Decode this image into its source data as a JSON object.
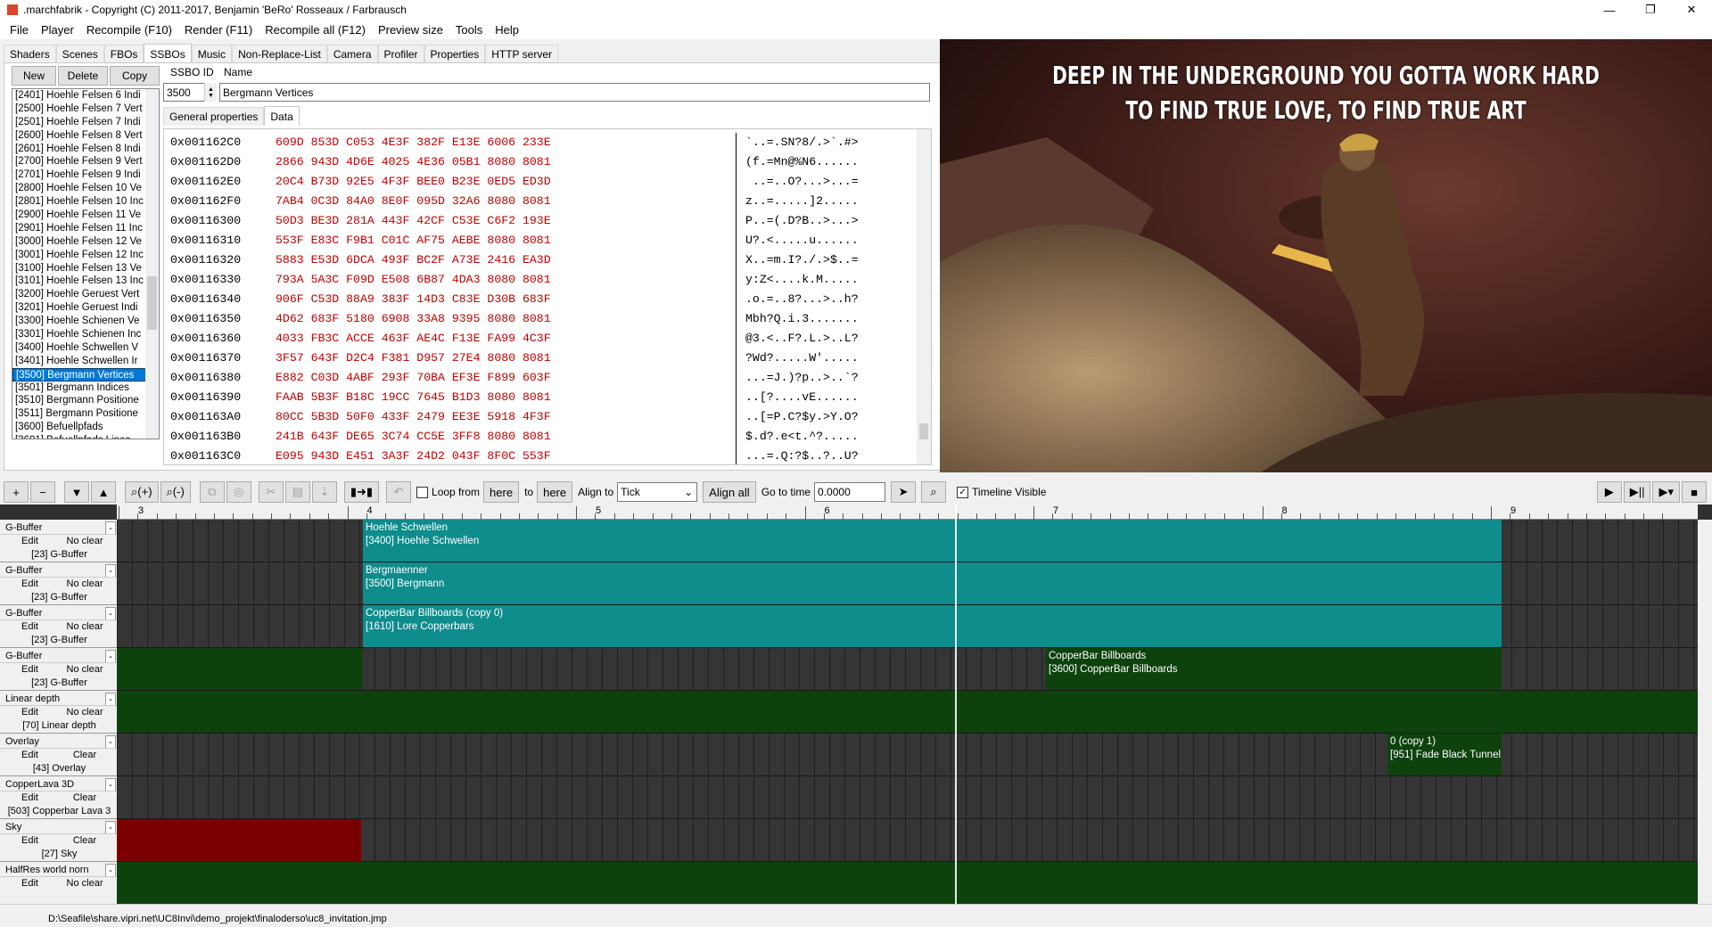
{
  "window": {
    "title": ".marchfabrik - Copyright (C) 2011-2017, Benjamin 'BeRo' Rosseaux / Farbrausch"
  },
  "menu": [
    "File",
    "Player",
    "Recompile (F10)",
    "Render (F11)",
    "Recompile all (F12)",
    "Preview size",
    "Tools",
    "Help"
  ],
  "tabs": [
    "Shaders",
    "Scenes",
    "FBOs",
    "SSBOs",
    "Music",
    "Non-Replace-List",
    "Camera",
    "Profiler",
    "Properties",
    "HTTP server"
  ],
  "active_tab": "SSBOs",
  "list_buttons": {
    "new": "New",
    "delete": "Delete",
    "copy": "Copy"
  },
  "ssbo_list": [
    "[2401] Hoehle Felsen 6 Indi",
    "[2500] Hoehle Felsen 7 Vert",
    "[2501] Hoehle Felsen 7 Indi",
    "[2600] Hoehle Felsen 8 Vert",
    "[2601] Hoehle Felsen 8 Indi",
    "[2700] Hoehle Felsen 9 Vert",
    "[2701] Hoehle Felsen 9 Indi",
    "[2800] Hoehle Felsen 10 Ve",
    "[2801] Hoehle Felsen 10 Inc",
    "[2900] Hoehle Felsen 11 Ve",
    "[2901] Hoehle Felsen 11 Inc",
    "[3000] Hoehle Felsen 12 Ve",
    "[3001] Hoehle Felsen 12 Inc",
    "[3100] Hoehle Felsen 13 Ve",
    "[3101] Hoehle Felsen 13 Inc",
    "[3200] Hoehle Geruest Vert",
    "[3201] Hoehle Geruest Indi",
    "[3300] Hoehle Schienen Ve",
    "[3301] Hoehle Schienen Inc",
    "[3400] Hoehle Schwellen V",
    "[3401] Hoehle Schwellen Ir",
    "[3500] Bergmann Vertices",
    "[3501] Bergmann Indices",
    "[3510] Bergmann Positione",
    "[3511] Bergmann Positione",
    "[3600] Befuellpfads",
    "[3601] Befuellpfads Lines"
  ],
  "selected_ssbo": "[3500] Bergmann Vertices",
  "form": {
    "id_label": "SSBO ID",
    "name_label": "Name",
    "id_value": "3500",
    "name_value": "Bergmann Vertices"
  },
  "subtabs": [
    "General properties",
    "Data"
  ],
  "hex_rows": [
    {
      "addr": "0x001162C0",
      "bytes": "609D 853D C053 4E3F 382F E13E 6006 233E",
      "ascii": "`..=.SN?8/.>`.#>"
    },
    {
      "addr": "0x001162D0",
      "bytes": "2866 943D 4D6E 4025 4E36 05B1 8080 8081",
      "ascii": "(f.=Mn@%N6......"
    },
    {
      "addr": "0x001162E0",
      "bytes": "20C4 B73D 92E5 4F3F BEE0 B23E 0ED5 ED3D",
      "ascii": " ..=..O?...>...="
    },
    {
      "addr": "0x001162F0",
      "bytes": "7AB4 0C3D 84A0 8E0F 095D 32A6 8080 8081",
      "ascii": "z..=.....]2....."
    },
    {
      "addr": "0x00116300",
      "bytes": "50D3 BE3D 281A 443F 42CF C53E C6F2 193E",
      "ascii": "P..=(.D?B..>...>"
    },
    {
      "addr": "0x00116310",
      "bytes": "553F E83C F9B1 C01C AF75 AEBE 8080 8081",
      "ascii": "U?.<.....u......"
    },
    {
      "addr": "0x00116320",
      "bytes": "5883 E53D 6DCA 493F BC2F A73E 2416 EA3D",
      "ascii": "X..=m.I?./.>$..="
    },
    {
      "addr": "0x00116330",
      "bytes": "793A 5A3C F09D E508 6B87 4DA3 8080 8081",
      "ascii": "y:Z<....k.M....."
    },
    {
      "addr": "0x00116340",
      "bytes": "906F C53D 88A9 383F 14D3 C83E D30B 683F",
      "ascii": ".o.=..8?...>..h?"
    },
    {
      "addr": "0x00116350",
      "bytes": "4D62 683F 5180 6908 33A8 9395 8080 8081",
      "ascii": "Mbh?Q.i.3......."
    },
    {
      "addr": "0x00116360",
      "bytes": "4033 FB3C ACCE 463F AE4C F13E FA99 4C3F",
      "ascii": "@3.<..F?.L.>..L?"
    },
    {
      "addr": "0x00116370",
      "bytes": "3F57 643F D2C4 F381 D957 27E4 8080 8081",
      "ascii": "?Wd?.....W'....."
    },
    {
      "addr": "0x00116380",
      "bytes": "E882 C03D 4ABF 293F 70BA EF3E F899 603F",
      "ascii": "...=J.)?p..>..`?"
    },
    {
      "addr": "0x00116390",
      "bytes": "FAAB 5B3F B18C 19CC 7645 B1D3 8080 8081",
      "ascii": "..[?....vE......"
    },
    {
      "addr": "0x001163A0",
      "bytes": "80CC 5B3D 50F0 433F 2479 EE3E 5918 4F3F",
      "ascii": "..[=P.C?$y.>Y.O?"
    },
    {
      "addr": "0x001163B0",
      "bytes": "241B 643F DE65 3C74 CC5E 3FF8 8080 8081",
      "ascii": "$.d?.e<t.^?....."
    },
    {
      "addr": "0x001163C0",
      "bytes": "E095 943D E451 3A3F 24D2 043F 8F0C 553F",
      "ascii": "...=.Q:?$..?..U?"
    }
  ],
  "preview": {
    "caption_line1": "DEEP IN THE UNDERGROUND YOU GOTTA WORK HARD",
    "caption_line2": "TO FIND TRUE LOVE, TO FIND TRUE ART"
  },
  "toolbar": {
    "add": "+",
    "remove": "−",
    "down": "▼",
    "up": "▲",
    "zoom_in": "⌕(+)",
    "zoom_out": "⌕(-)",
    "loop_from": "Loop from",
    "here1": "here",
    "to": "to",
    "here2": "here",
    "align_to": "Align to",
    "align_value": "Tick",
    "align_all": "Align all",
    "go_to_time": "Go to time",
    "time_value": "0.0000",
    "timeline_visible": "Timeline Visible"
  },
  "ruler_labels": [
    "3",
    "4",
    "5",
    "6",
    "7",
    "8",
    "9"
  ],
  "tracks": [
    {
      "name": "G-Buffer",
      "edit": "Edit",
      "mode": "No clear",
      "target": "[23] G-Buffer"
    },
    {
      "name": "G-Buffer",
      "edit": "Edit",
      "mode": "No clear",
      "target": "[23] G-Buffer"
    },
    {
      "name": "G-Buffer",
      "edit": "Edit",
      "mode": "No clear",
      "target": "[23] G-Buffer"
    },
    {
      "name": "G-Buffer",
      "edit": "Edit",
      "mode": "No clear",
      "target": "[23] G-Buffer"
    },
    {
      "name": "Linear depth",
      "edit": "Edit",
      "mode": "No clear",
      "target": "[70] Linear depth"
    },
    {
      "name": "Overlay",
      "edit": "Edit",
      "mode": "Clear",
      "target": "[43] Overlay"
    },
    {
      "name": "CopperLava 3D",
      "edit": "Edit",
      "mode": "Clear",
      "target": "[503] Copperbar Lava 3"
    },
    {
      "name": "Sky",
      "edit": "Edit",
      "mode": "Clear",
      "target": "[27] Sky"
    },
    {
      "name": "HalfRes world norn",
      "edit": "Edit",
      "mode": "No clear",
      "target": ""
    }
  ],
  "clips": [
    {
      "title": "Hoehle Schwellen",
      "sub": "[3400] Hoehle Schwellen"
    },
    {
      "title": "Bergmaenner",
      "sub": "[3500] Bergmann"
    },
    {
      "title": "CopperBar Billboards (copy 0)",
      "sub": "[1610] Lore Copperbars"
    },
    {
      "title": "CopperBar Billboards",
      "sub": "[3600] CopperBar Billboards"
    },
    {
      "title": "0 (copy 1)",
      "sub": "[951] Fade Black Tunnel"
    }
  ],
  "colors": {
    "teal": "#0f8c8c",
    "green": "#0d420d",
    "red": "#7a0000",
    "lane": "#353535"
  },
  "status_path": "D:\\Seafile\\share.vipri.net\\UC8Invi\\demo_projekt\\finaloderso\\uc8_invitation.jmp"
}
